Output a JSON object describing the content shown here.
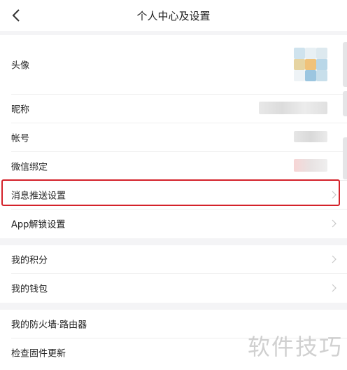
{
  "header": {
    "title": "个人中心及设置"
  },
  "profile": {
    "avatar_label": "头像",
    "nickname_label": "昵称",
    "account_label": "帐号",
    "wechat_label": "微信绑定",
    "push_label": "消息推送设置",
    "app_lock_label": "App解锁设置"
  },
  "wallet": {
    "points_label": "我的积分",
    "wallet_label": "我的钱包"
  },
  "device": {
    "firewall_label": "我的防火墙·路由器",
    "firmware_label": "检查固件更新"
  },
  "watermark": "软件技巧",
  "colors": {
    "highlight": "#d4222a",
    "background": "#f4f4f6"
  }
}
